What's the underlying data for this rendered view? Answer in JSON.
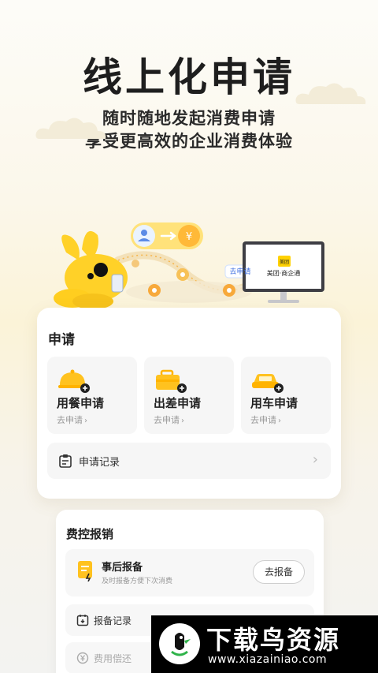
{
  "header": {
    "title": "线上化申请",
    "subtitle_line1": "随时随地发起消费申请",
    "subtitle_line2": "享受更高效的企业消费体验"
  },
  "illustration": {
    "bubble_label": "去申请",
    "monitor_logo": "美团",
    "monitor_text": "美团·商企通",
    "accent_color": "#ffd100"
  },
  "apply_card": {
    "title": "申请",
    "tiles": [
      {
        "label": "用餐申请",
        "sub": "去申请",
        "icon": "dining-cloche-icon"
      },
      {
        "label": "出差申请",
        "sub": "去申请",
        "icon": "suitcase-icon"
      },
      {
        "label": "用车申请",
        "sub": "去申请",
        "icon": "car-icon"
      }
    ],
    "records_label": "申请记录",
    "records_chevron": "›"
  },
  "expense_card": {
    "title": "费控报销",
    "item": {
      "label": "事后报备",
      "sub": "及时报备方便下次消费",
      "button": "去报备"
    },
    "rows": [
      {
        "label": "报备记录"
      },
      {
        "label": "费用偿还"
      }
    ]
  },
  "watermark": {
    "text": "下载鸟资源",
    "url": "www.xiazainiao.com"
  }
}
